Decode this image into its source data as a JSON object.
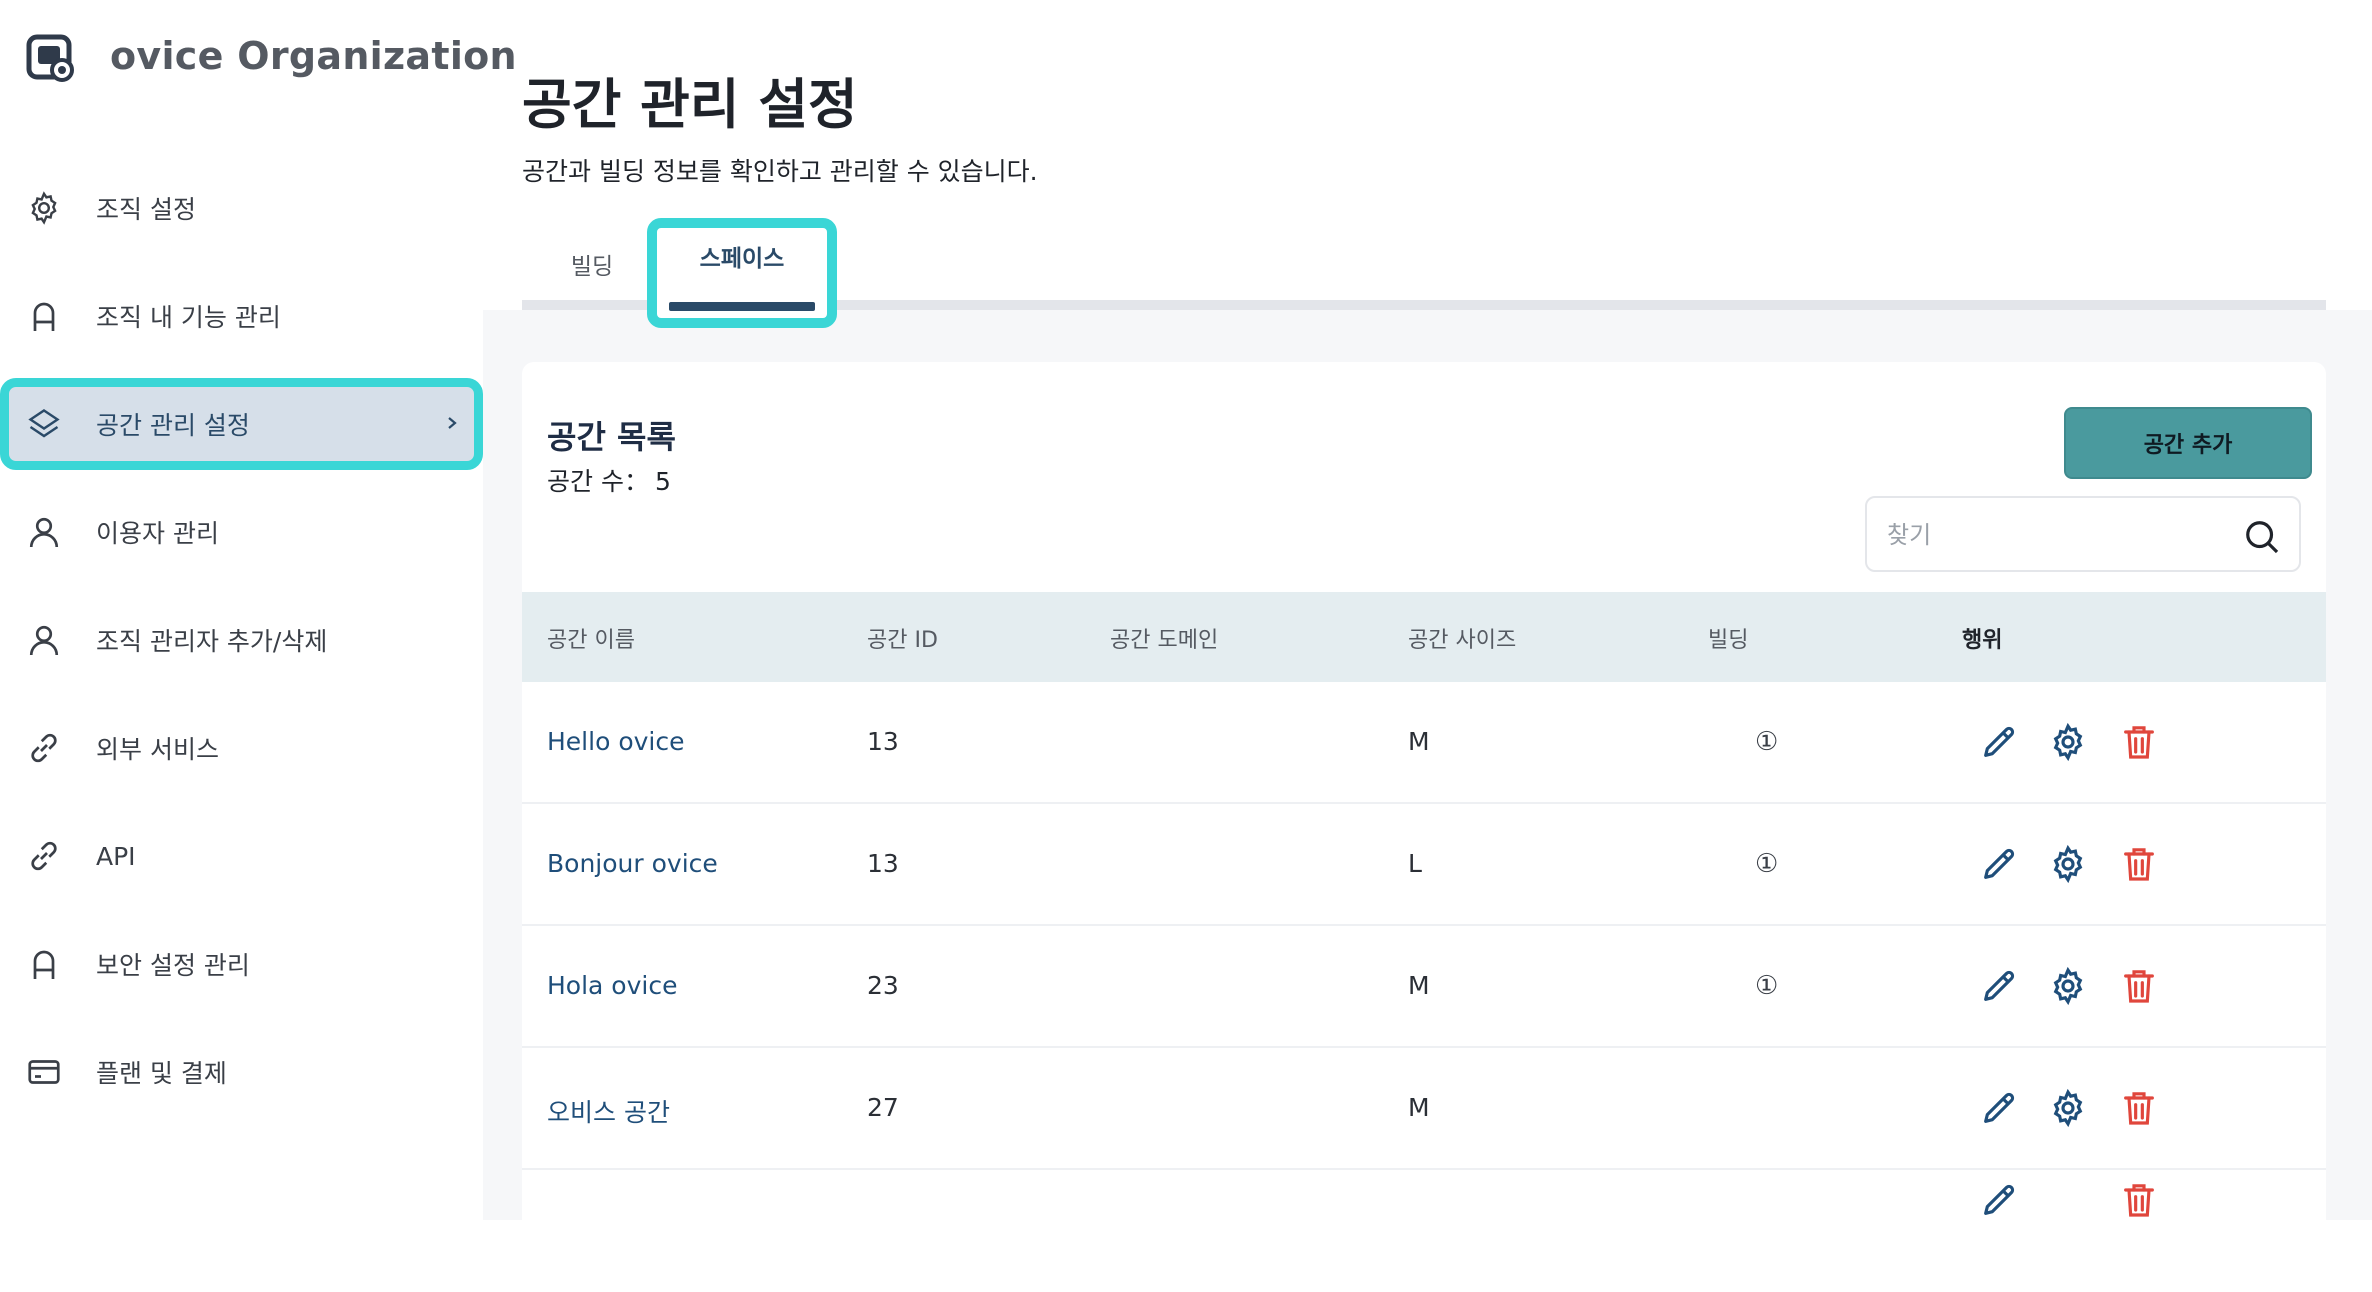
{
  "org": {
    "name": "ovice Organization"
  },
  "sidebar": {
    "items": [
      {
        "label": "조직 설정",
        "icon": "gear-icon"
      },
      {
        "label": "조직 내 기능 관리",
        "icon": "lock-icon"
      },
      {
        "label": "공간 관리 설정",
        "icon": "layers-icon",
        "active": true
      },
      {
        "label": "이용자 관리",
        "icon": "user-icon"
      },
      {
        "label": "조직 관리자 추가/삭제",
        "icon": "user-icon"
      },
      {
        "label": "외부 서비스",
        "icon": "link-icon"
      },
      {
        "label": "API",
        "icon": "link-icon"
      },
      {
        "label": "보안 설정 관리",
        "icon": "lock-icon"
      },
      {
        "label": "플랜 및 결제",
        "icon": "credit-card-icon"
      }
    ]
  },
  "page": {
    "title": "공간 관리 설정",
    "description": "공간과 빌딩 정보를 확인하고 관리할 수 있습니다."
  },
  "tabs": [
    {
      "label": "빌딩"
    },
    {
      "label": "스페이스",
      "active": true
    }
  ],
  "list": {
    "title": "공간 목록",
    "count_label": "공간 수：",
    "count": "5",
    "add_button": "공간 추가",
    "search_placeholder": "찾기"
  },
  "table": {
    "headers": [
      "공간 이름",
      "공간 ID",
      "공간 도메인",
      "공간 사이즈",
      "빌딩",
      "행위"
    ],
    "rows": [
      {
        "name": "Hello ovice",
        "id": "13",
        "domain": "",
        "size": "M",
        "building": "①"
      },
      {
        "name": "Bonjour ovice",
        "id": "13",
        "domain": "",
        "size": "L",
        "building": "①"
      },
      {
        "name": "Hola ovice",
        "id": "23",
        "domain": "",
        "size": "M",
        "building": "①"
      },
      {
        "name": "오비스 공간",
        "id": "27",
        "domain": "",
        "size": "M",
        "building": ""
      }
    ]
  },
  "colors": {
    "accent_highlight": "#3ad6d6",
    "add_button": "#4a9a9e",
    "link_text": "#1f4e7a",
    "action_edit": "#1f4e7a",
    "action_delete": "#e0463c"
  }
}
